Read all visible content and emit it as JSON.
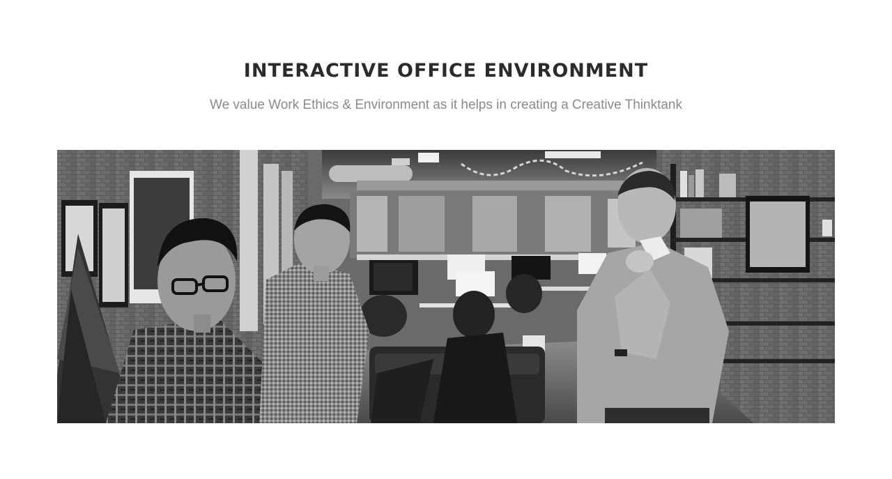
{
  "section": {
    "title": "INTERACTIVE OFFICE ENVIRONMENT",
    "subtitle": "We value Work Ethics & Environment as it helps in creating a Creative Thinktank"
  },
  "photo": {
    "style": "black-and-white",
    "subject": "office-team-photo"
  }
}
